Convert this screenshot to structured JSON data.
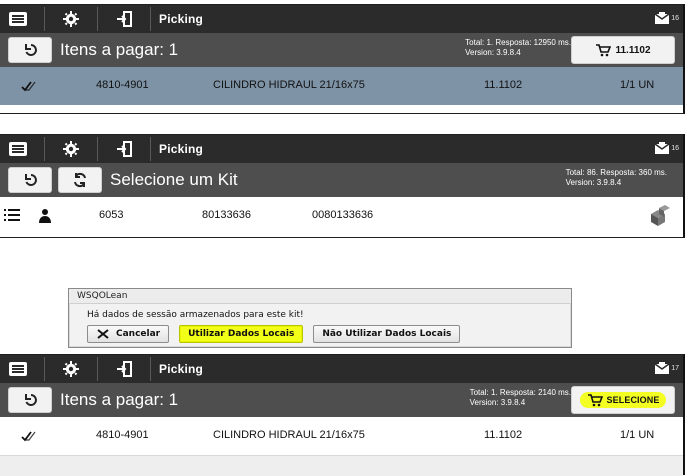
{
  "panels": [
    {
      "topbar": {
        "label": "Picking",
        "message_count": "16"
      },
      "subbar": {
        "title": "Itens a pagar: 1",
        "status_line1": "Total: 1. Resposta: 12950 ms.",
        "status_line2": "Version: 3.9.8.4",
        "cart_label": "11.1102"
      },
      "row": {
        "code": "4810-4901",
        "description": "CILINDRO HIDRAUL 21/16x75",
        "value": "11.1102",
        "qty": "1/1 UN"
      }
    },
    {
      "topbar": {
        "label": "Picking",
        "message_count": "16"
      },
      "subbar": {
        "title": "Selecione um Kit",
        "status_line1": "Total: 86. Resposta: 360 ms.",
        "status_line2": "Version: 3.9.8.4"
      },
      "row": {
        "col1": "6053",
        "col2": "80133636",
        "col3": "0080133636"
      }
    },
    {
      "topbar": {
        "label": "Picking",
        "message_count": "17"
      },
      "subbar": {
        "title": "Itens a pagar: 1",
        "status_line1": "Total: 1. Resposta: 2140 ms.",
        "status_line2": "Version: 3.9.8.4",
        "cart_label": "SELECIONE"
      },
      "row": {
        "code": "4810-4901",
        "description": "CILINDRO HIDRAUL 21/16x75",
        "value": "11.1102",
        "qty": "1/1 UN"
      }
    }
  ],
  "dialog": {
    "title": "WSQOLean",
    "message": "Há dados de sessão armazenados para este kit!",
    "buttons": {
      "cancel": "Cancelar",
      "use_local": "Utilizar Dados Locais",
      "no_local": "Não Utilizar Dados Locais"
    }
  },
  "colors": {
    "topbar": "#2b2b2b",
    "subbar": "#4e4e4e",
    "selected_row": "#7f93a7",
    "highlight": "#f2ff17"
  },
  "icons": {
    "menu": "menu-icon",
    "settings": "gear-icon",
    "logout": "logout-icon",
    "message": "message-icon",
    "back": "back-icon",
    "refresh": "refresh-icon",
    "cart": "cart-icon",
    "checkmark": "double-check-icon",
    "list": "list-icon",
    "person": "person-icon",
    "boxes": "boxes-icon",
    "close": "close-icon"
  }
}
